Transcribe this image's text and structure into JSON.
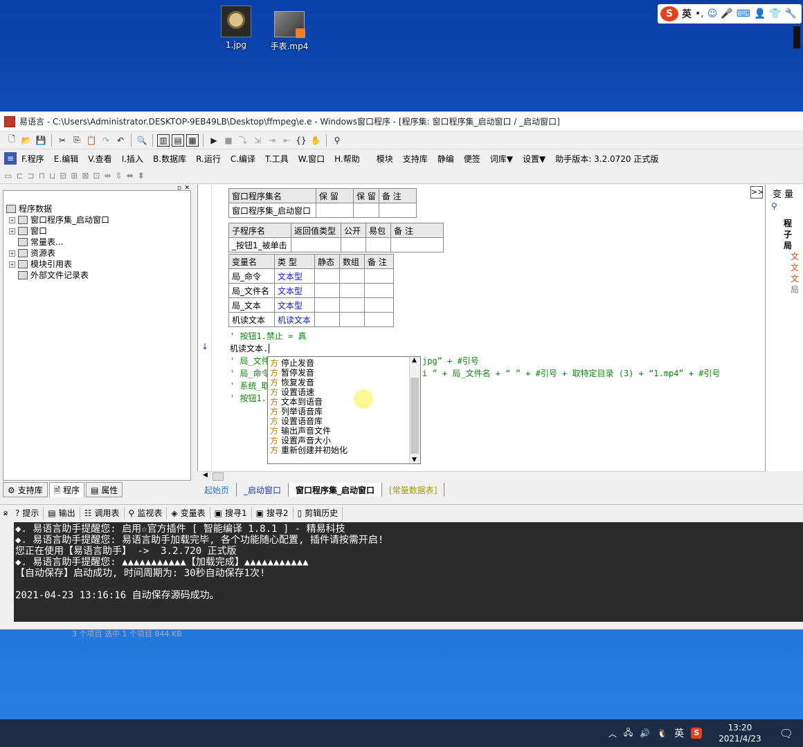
{
  "desktop": {
    "icons": [
      {
        "label": "1.jpg"
      },
      {
        "label": "手表.mp4"
      }
    ]
  },
  "ime": {
    "label": "英"
  },
  "window": {
    "title": "易语言 - C:\\Users\\Administrator.DESKTOP-9EB49LB\\Desktop\\ffmpeg\\e.e - Windows窗口程序 - [程序集: 窗口程序集_启动窗口 / _启动窗口]",
    "menu": [
      {
        "label": "F.程序"
      },
      {
        "label": "E.编辑"
      },
      {
        "label": "V.查看"
      },
      {
        "label": "I.插入"
      },
      {
        "label": "B.数据库"
      },
      {
        "label": "R.运行"
      },
      {
        "label": "C.编译"
      },
      {
        "label": "T.工具"
      },
      {
        "label": "W.窗口"
      },
      {
        "label": "H.帮助"
      },
      {
        "label": "模块"
      },
      {
        "label": "支持库"
      },
      {
        "label": "静编"
      },
      {
        "label": "便签"
      },
      {
        "label": "词库▼"
      },
      {
        "label": "设置▼"
      },
      {
        "label": "助手版本: 3.2.0720 正式版"
      }
    ]
  },
  "tree": {
    "root": "程序数据",
    "items": [
      {
        "label": "窗口程序集_启动窗口"
      },
      {
        "label": "窗口"
      },
      {
        "label": "常量表..."
      },
      {
        "label": "资源表"
      },
      {
        "label": "模块引用表"
      },
      {
        "label": "外部文件记录表"
      }
    ]
  },
  "left_tabs": [
    "支持库",
    "程序",
    "属性"
  ],
  "editor": {
    "set_table": {
      "headers": [
        "窗口程序集名",
        "保 留",
        "保 留",
        "备 注"
      ],
      "row": [
        "窗口程序集_启动窗口",
        "",
        "",
        ""
      ]
    },
    "sub_table": {
      "headers": [
        "子程序名",
        "返回值类型",
        "公开",
        "易包",
        "备 注"
      ],
      "row": [
        "_按钮1_被单击",
        "",
        "",
        "",
        ""
      ]
    },
    "var_table": {
      "headers": [
        "变量名",
        "类 型",
        "静态",
        "数组",
        "备 注"
      ],
      "rows": [
        [
          "局_命令",
          "文本型"
        ],
        [
          "局_文件名",
          "文本型"
        ],
        [
          "局_文本",
          "文本型"
        ],
        [
          "机读文本",
          "机读文本"
        ]
      ]
    },
    "lines": [
      "' 按钮1.禁止 = 真",
      "机读文本.",
      "' 局_文件",
      "' 局_命令",
      "' 系统_取",
      "' 按钮1.禁"
    ],
    "line_tail_1": "jpg” + #引号",
    "line_tail_2": "i ” + 局_文件名 + “ ” + #引号 + 取特定目录 (3) + “1.mp4” + #引号",
    "autocomplete": [
      "停止发音",
      "暂停发音",
      "恢复发音",
      "设置语速",
      "文本到语音",
      "列举语音库",
      "设置语音库",
      "输出声音文件",
      "设置声音大小",
      "重新创建并初始化"
    ],
    "autocomplete_kind": "方",
    "right_panel_title": "变 量",
    "right_panel_items": [
      "程",
      "子",
      "局",
      "文",
      "文",
      "文",
      "局"
    ]
  },
  "editor_tabs": [
    "起始页",
    "_启动窗口",
    "窗口程序集_启动窗口",
    "[常量数据表]"
  ],
  "output_tabs": [
    "提示",
    "输出",
    "调用表",
    "监视表",
    "变量表",
    "搜寻1",
    "搜寻2",
    "剪辑历史"
  ],
  "output_lines": [
    "◆. 易语言助手提醒您: 启用☆官方插件 [ 智能编译 1.8.1 ] - 精易科技",
    "◆. 易语言助手提醒您: 易语言助手加载完毕, 各个功能随心配置, 插件请按需开启!",
    "您正在使用【易语言助手】 ->  3.2.720 正式版",
    "◆. 易语言助手提醒您: ▲▲▲▲▲▲▲▲▲▲▲【加载完成】▲▲▲▲▲▲▲▲▲▲▲",
    "【自动保存】启动成功, 时间周期为: 30秒自动保存1次!",
    "",
    "2021-04-23 13:16:16 自动保存源码成功。"
  ],
  "explorer_status": "3 个项目    选中 1 个项目  844 KB",
  "taskbar": {
    "ime": "英",
    "time": "13:20",
    "date": "2021/4/23"
  }
}
